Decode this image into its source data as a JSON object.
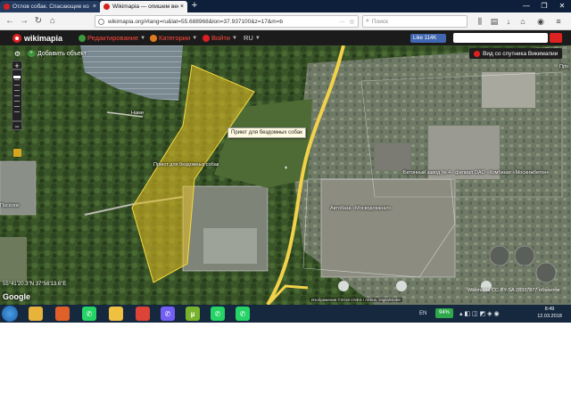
{
  "browser": {
    "tabs": [
      {
        "title": "Отлов собак. Спасающие ко",
        "active": false
      },
      {
        "title": "Wikimapia — опишем весь м",
        "active": true
      }
    ],
    "new_tab_glyph": "+",
    "url": "wikimapia.org/#lang=ru&lat=55.688968&lon=37.937100&z=17&m=b",
    "url_more": "···",
    "search_placeholder": "Поиск"
  },
  "wikimapia": {
    "logo": "wikimapia",
    "menu": [
      {
        "label": "Редактирование",
        "icon": "globe-icon",
        "color": "#3c9a3c"
      },
      {
        "label": "Категории",
        "icon": "category-icon",
        "color": "#e07a20"
      },
      {
        "label": "Войти",
        "icon": "login-icon",
        "color": "#d82020"
      },
      {
        "label": "RU",
        "icon": "",
        "color": ""
      }
    ],
    "fb_like": "Like 114K",
    "add_object": "Добавить объект",
    "satellite_button": "Вид со спутника Викимапии"
  },
  "map": {
    "tooltip": "Приют для бездомных собак",
    "labels": [
      {
        "text": "Нами",
        "name": "label-nami"
      },
      {
        "text": "Приют для бездомных собак",
        "name": "label-shelter"
      },
      {
        "text": "Бетонный завод № 4 - филиал ОАО «Комбинат «Мосинжбетон»",
        "name": "label-concrete-plant"
      },
      {
        "text": "Автобаза «Мосводоканал»",
        "name": "label-autobase"
      },
      {
        "text": "Посёлок",
        "name": "label-village"
      },
      {
        "text": "Про",
        "name": "label-pro"
      }
    ],
    "coords": "55°41'20.3\"N 37°56'13.6\"E",
    "google": "Google",
    "attribution": "Изображения ©2018 CNES / Airbus, DigitalGlobe",
    "license": "Wikimapia CC-BY-SA  28337877 объектов",
    "colors": {
      "polygon_fill": "#e8c020",
      "road": "#f2d24a"
    }
  },
  "taskbar": {
    "apps": [
      {
        "name": "explorer",
        "icon": "folder-icon",
        "color": "#e8b33a"
      },
      {
        "name": "media",
        "icon": "media-player-icon",
        "color": "#e07020"
      },
      {
        "name": "firefox",
        "icon": "firefox-icon",
        "color": "#e0602a"
      },
      {
        "name": "whatsapp",
        "icon": "whatsapp-icon",
        "color": "#25d366"
      },
      {
        "name": "files",
        "icon": "file-manager-icon",
        "color": "#f0c040"
      },
      {
        "name": "chrome",
        "icon": "chrome-icon",
        "color": "#db4437"
      },
      {
        "name": "viber",
        "icon": "viber-icon",
        "color": "#7360f2"
      },
      {
        "name": "torrent",
        "icon": "torrent-icon",
        "color": "#78b42b"
      },
      {
        "name": "whatsapp2",
        "icon": "whatsapp-icon",
        "color": "#25d366"
      },
      {
        "name": "whatsapp3",
        "icon": "whatsapp-icon",
        "color": "#25d366"
      }
    ],
    "lang": "EN",
    "battery": "94%",
    "time": "8:49",
    "date": "12.03.2018"
  }
}
